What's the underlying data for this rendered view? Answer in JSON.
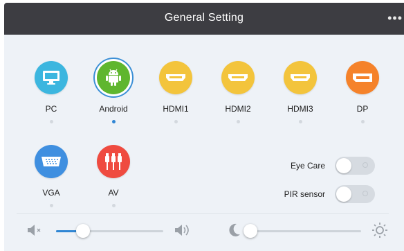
{
  "header": {
    "title": "General Setting",
    "more_icon": "more-dots-icon"
  },
  "sources": [
    {
      "label": "PC",
      "icon": "monitor-icon",
      "color": "#3cb6df",
      "selected": false
    },
    {
      "label": "Android",
      "icon": "android-icon",
      "color": "#5fb62e",
      "selected": true
    },
    {
      "label": "HDMI1",
      "icon": "hdmi-icon",
      "color": "#f3c43c",
      "selected": false
    },
    {
      "label": "HDMI2",
      "icon": "hdmi-icon",
      "color": "#f3c43c",
      "selected": false
    },
    {
      "label": "HDMI3",
      "icon": "hdmi-icon",
      "color": "#f3c43c",
      "selected": false
    },
    {
      "label": "DP",
      "icon": "displayport-icon",
      "color": "#f5822a",
      "selected": false
    },
    {
      "label": "VGA",
      "icon": "vga-icon",
      "color": "#3f8fe0",
      "selected": false
    },
    {
      "label": "AV",
      "icon": "av-rca-icon",
      "color": "#ef4b40",
      "selected": false
    }
  ],
  "toggles": {
    "eye_care": {
      "label": "Eye Care",
      "on": false
    },
    "pir_sensor": {
      "label": "PIR sensor",
      "on": false
    }
  },
  "volume": {
    "level": 0.25,
    "min_icon": "speaker-mute-icon",
    "max_icon": "speaker-icon"
  },
  "brightness": {
    "level": 0.0,
    "min_icon": "moon-icon",
    "max_icon": "sun-icon"
  },
  "accent_color": "#2f86d4"
}
